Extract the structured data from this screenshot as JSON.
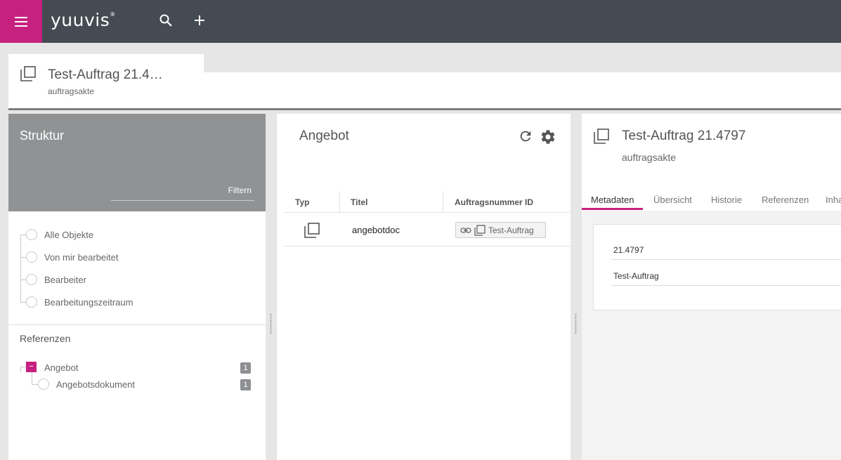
{
  "app": {
    "logo": "yuuvis",
    "logo_mark": "®"
  },
  "colors": {
    "brand": "#c7217f",
    "topbar": "#444b52",
    "panel_header": "#909294"
  },
  "topbar": {
    "menu_icon": "menu-icon",
    "search_icon": "search-icon",
    "add_icon": "add-icon"
  },
  "object_tab": {
    "title": "Test-Auftrag 21.4…",
    "subtitle": "auftragsakte",
    "icon": "document-stack-icon"
  },
  "structure": {
    "title": "Struktur",
    "filter_placeholder": "Filtern",
    "items": [
      {
        "label": "Alle Objekte"
      },
      {
        "label": "Von mir bearbeitet"
      },
      {
        "label": "Bearbeiter"
      },
      {
        "label": "Bearbeitungszeitraum"
      }
    ],
    "references_title": "Referenzen",
    "references": [
      {
        "label": "Angebot",
        "count": "1",
        "expand_symbol": "−"
      },
      {
        "label": "Angebotsdokument",
        "count": "1"
      }
    ]
  },
  "results": {
    "title": "Angebot",
    "refresh_icon": "refresh-icon",
    "settings_icon": "gear-icon",
    "columns": [
      "Typ",
      "Titel",
      "Auftragsnummer ID"
    ],
    "rows": [
      {
        "type_icon": "document-stack-icon",
        "title": "angebotdoc",
        "reference": "Test-Auftrag"
      }
    ]
  },
  "details": {
    "title": "Test-Auftrag 21.4797",
    "subtitle": "auftragsakte",
    "tabs": [
      "Metadaten",
      "Übersicht",
      "Historie",
      "Referenzen",
      "Inha"
    ],
    "active_tab": "Metadaten",
    "fields": [
      {
        "value": "21.4797"
      },
      {
        "value": "Test-Auftrag"
      }
    ]
  }
}
